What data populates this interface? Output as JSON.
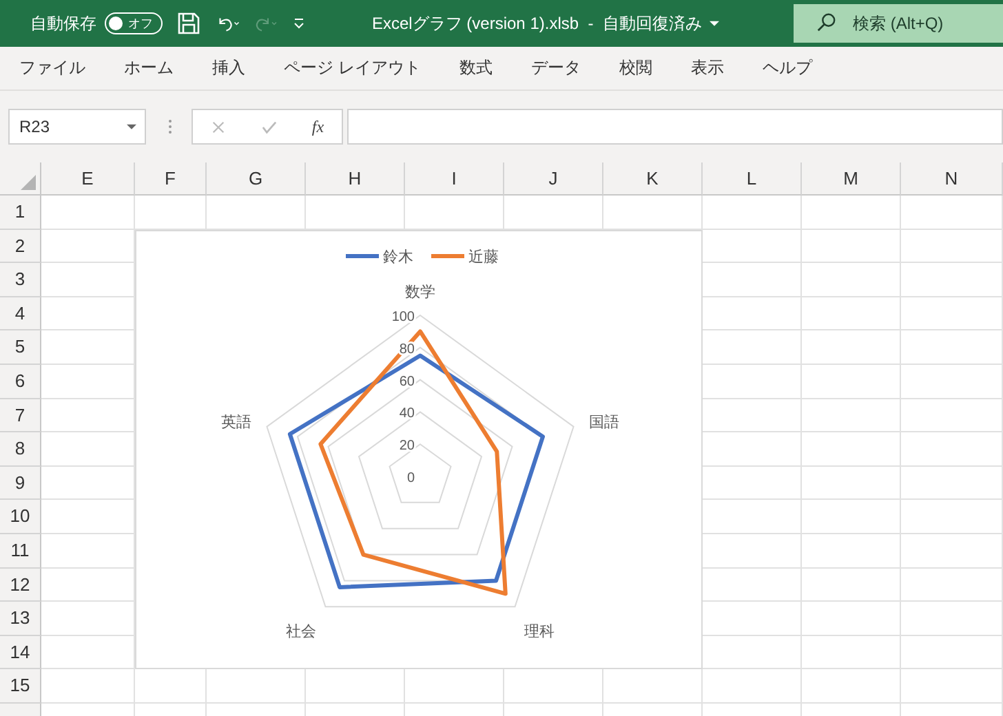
{
  "title_bar": {
    "autosave_label": "自動保存",
    "autosave": {
      "on": false,
      "label": "オフ"
    },
    "file_title": "Excelグラフ (version 1).xlsb  -  自動回復済み",
    "search_placeholder": "検索 (Alt+Q)"
  },
  "ribbon_tabs": [
    "ファイル",
    "ホーム",
    "挿入",
    "ページ レイアウト",
    "数式",
    "データ",
    "校閲",
    "表示",
    "ヘルプ"
  ],
  "formula_bar": {
    "name_box": "R23",
    "function_label": "fx"
  },
  "columns": [
    "E",
    "F",
    "G",
    "H",
    "I",
    "J",
    "K",
    "L",
    "M",
    "N"
  ],
  "rows": [
    "1",
    "2",
    "3",
    "4",
    "5",
    "6",
    "7",
    "8",
    "9",
    "10",
    "11",
    "12",
    "13",
    "14",
    "15"
  ],
  "chart": {
    "chart_data": {
      "type": "radar",
      "legend": "top",
      "categories": [
        "数学",
        "国語",
        "理科",
        "社会",
        "英語"
      ],
      "ylim": [
        0,
        100
      ],
      "yticks": [
        0,
        20,
        40,
        60,
        80,
        100
      ],
      "series": [
        {
          "name": "鈴木",
          "color": "#4472c4",
          "values": [
            75,
            80,
            80,
            85,
            85
          ]
        },
        {
          "name": "近藤",
          "color": "#ed7d31",
          "values": [
            90,
            50,
            90,
            60,
            65
          ]
        }
      ]
    }
  }
}
